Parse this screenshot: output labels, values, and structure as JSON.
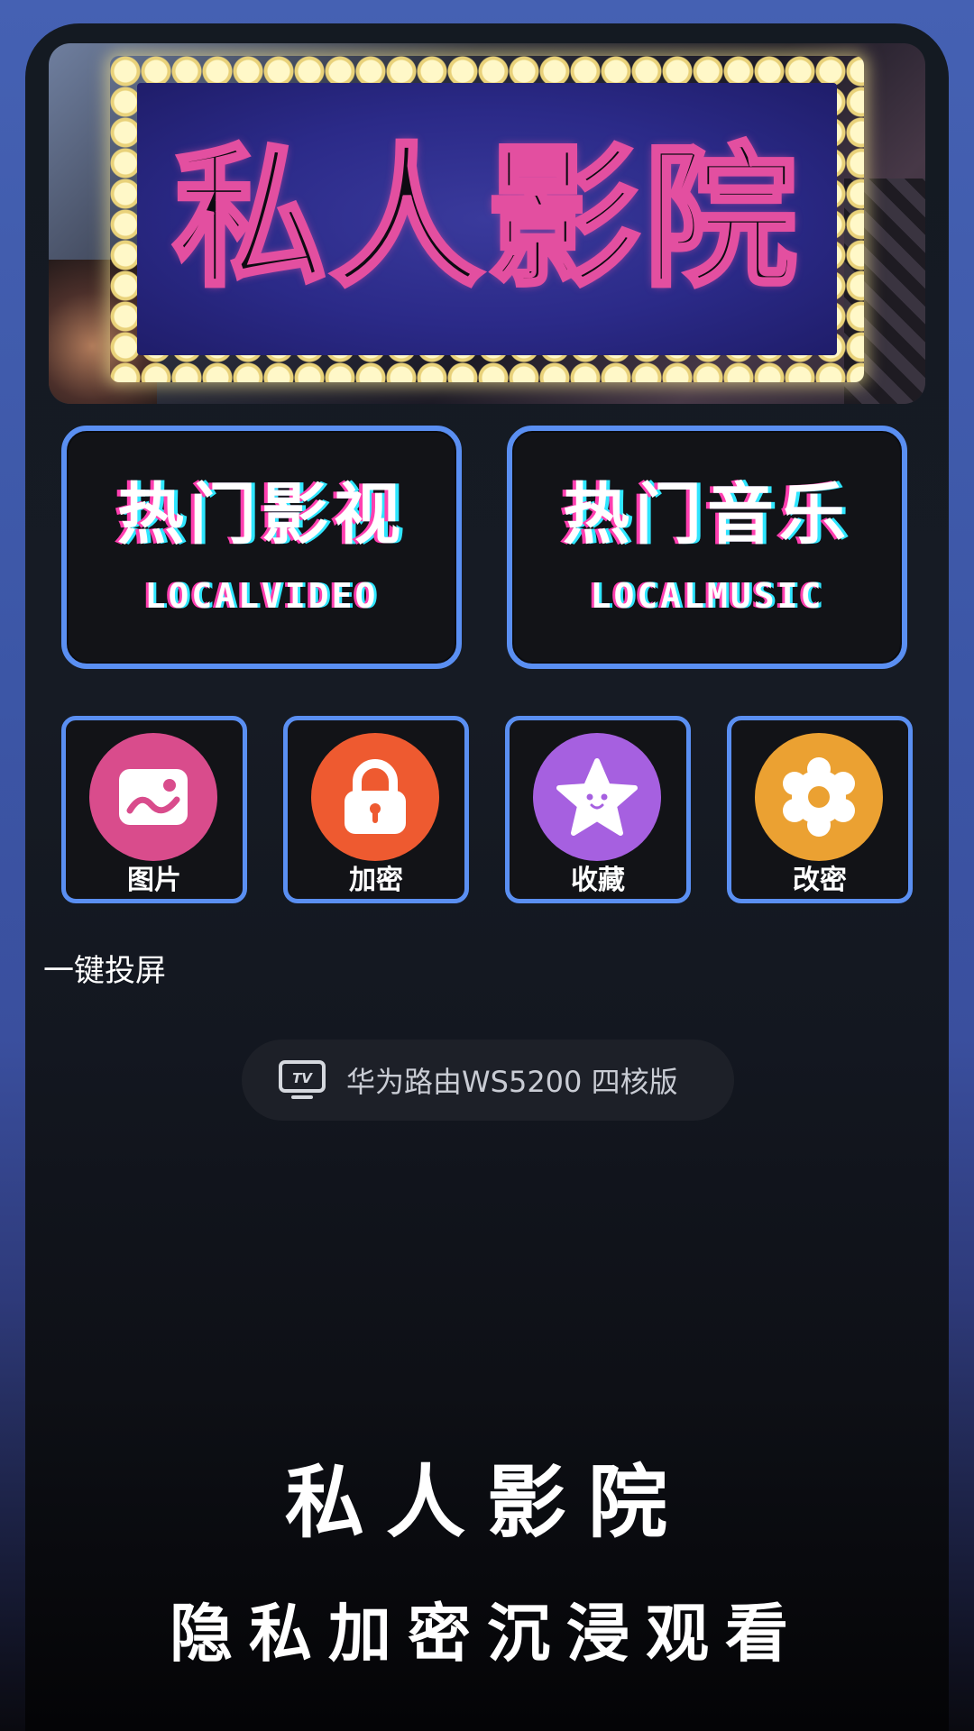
{
  "banner": {
    "title": "私人影院"
  },
  "big_tiles": [
    {
      "title": "热门影视",
      "subtitle": "LOCALVIDEO"
    },
    {
      "title": "热门音乐",
      "subtitle": "LOCALMUSIC"
    }
  ],
  "small_tiles": [
    {
      "label": "图片",
      "icon": "image-icon",
      "color": "#d94c8c"
    },
    {
      "label": "加密",
      "icon": "lock-icon",
      "color": "#ee5a30"
    },
    {
      "label": "收藏",
      "icon": "star-icon",
      "color": "#a660e0"
    },
    {
      "label": "改密",
      "icon": "gear-icon",
      "color": "#eba132"
    }
  ],
  "cast": {
    "section_label": "一键投屏",
    "device": "华为路由WS5200 四核版",
    "icon": "tv-icon"
  },
  "footer": {
    "title": "私人影院",
    "subtitle": "隐私加密沉浸观看"
  },
  "colors": {
    "accent_border": "#5a8ff2",
    "background_top": "#4561b3"
  }
}
